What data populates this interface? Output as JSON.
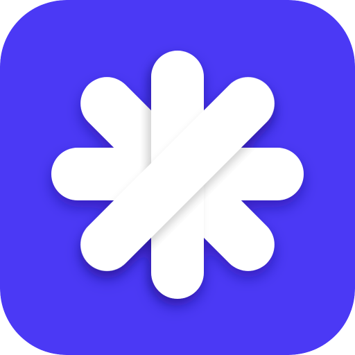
{
  "app_icon": {
    "icon": "asterisk-icon",
    "colors": {
      "background": "#4B39F5",
      "glyph": "#FFFFFF",
      "glyph_shade": "#E4E4EA"
    }
  }
}
